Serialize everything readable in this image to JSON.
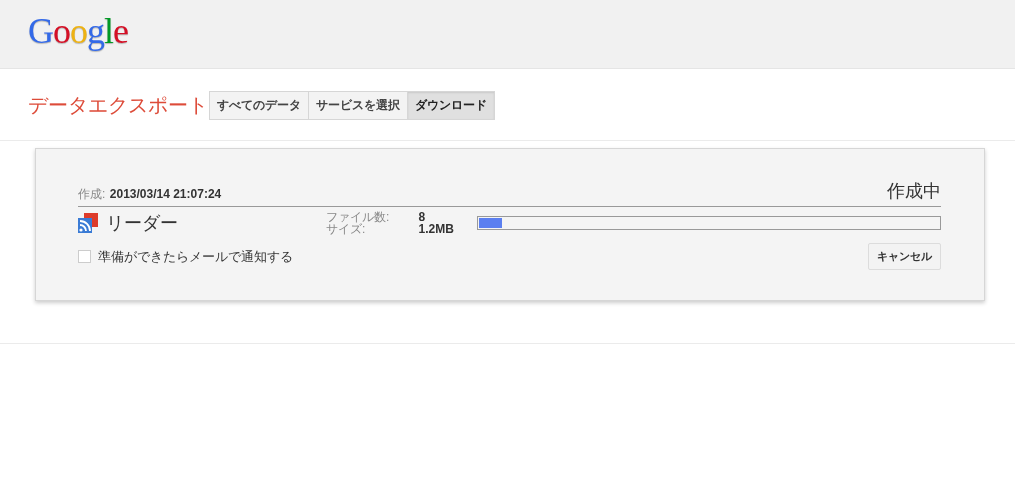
{
  "header": {
    "logo": "Google"
  },
  "page": {
    "title": "データエクスポート",
    "tabs": [
      {
        "label": "すべてのデータ",
        "selected": false
      },
      {
        "label": "サービスを選択",
        "selected": false
      },
      {
        "label": "ダウンロード",
        "selected": true
      }
    ]
  },
  "export": {
    "created_label": "作成:",
    "created_value": "2013/03/14 21:07:24",
    "status": "作成中",
    "service": {
      "name": "リーダー",
      "files_label": "ファイル数:",
      "files_value": "8",
      "size_label": "サイズ:",
      "size_value": "1.2MB",
      "level": 0.05
    },
    "notify": {
      "label": "準備ができたらメールで通知する",
      "checked": false
    },
    "cancel": "キャンセル"
  }
}
